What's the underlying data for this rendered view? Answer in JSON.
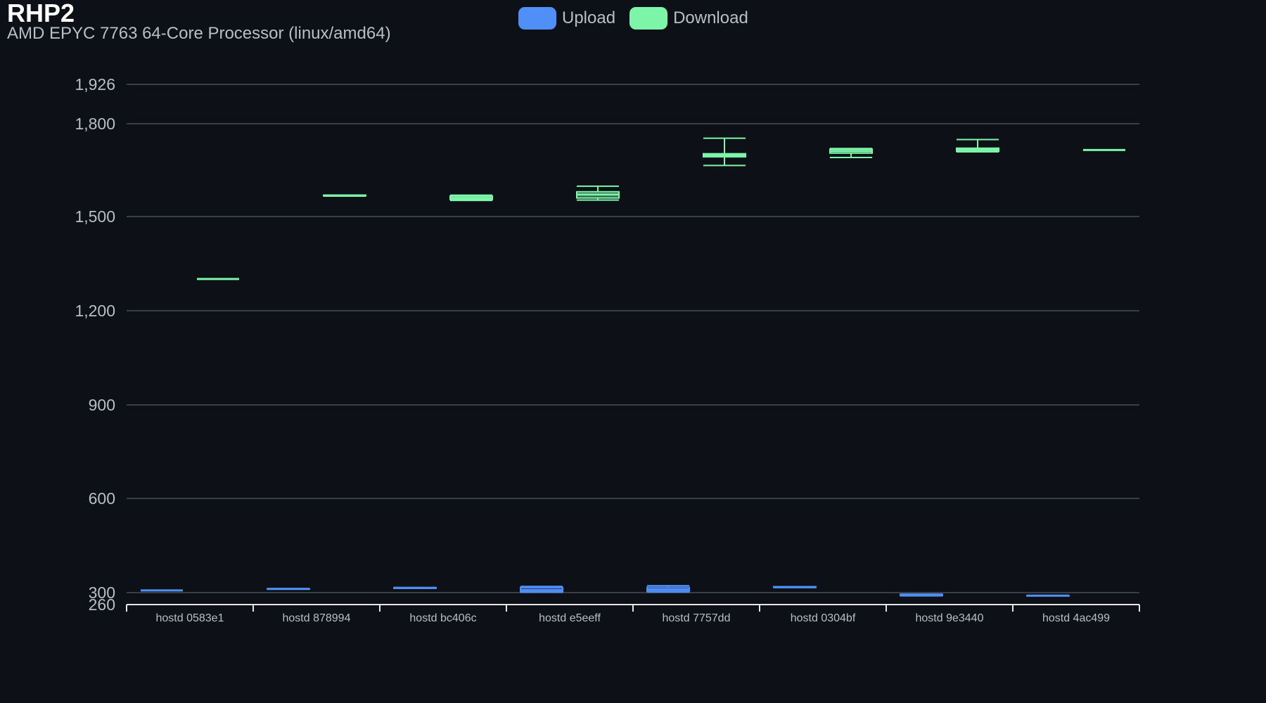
{
  "header": {
    "title": "RHP2",
    "subtitle": "AMD EPYC 7763 64-Core Processor (linux/amd64)"
  },
  "chart_data": {
    "type": "boxplot",
    "title": "RHP2",
    "subtitle": "AMD EPYC 7763 64-Core Processor (linux/amd64)",
    "xlabel": "",
    "ylabel": "",
    "ylim": [
      260,
      1926
    ],
    "yticks": [
      1926,
      1800,
      1500,
      1200,
      900,
      600,
      300,
      260
    ],
    "ytick_labels": [
      "1,926",
      "1,800",
      "1,500",
      "1,200",
      "900",
      "600",
      "300",
      "260"
    ],
    "grid": true,
    "legend_position": "top-center",
    "categories": [
      "hostd 0583e1",
      "hostd 878994",
      "hostd bc406c",
      "hostd e5eeff",
      "hostd 7757dd",
      "hostd 0304bf",
      "hostd 9e3440",
      "hostd 4ac499"
    ],
    "series": [
      {
        "name": "Upload",
        "color": "#4f8ff7",
        "boxes": [
          {
            "min": 307,
            "q1": 307,
            "median": 307,
            "q3": 307,
            "max": 307
          },
          {
            "min": 311,
            "q1": 311,
            "median": 312,
            "q3": 312,
            "max": 312
          },
          {
            "min": 314,
            "q1": 314,
            "median": 315,
            "q3": 316,
            "max": 316
          },
          {
            "min": 301,
            "q1": 303,
            "median": 308,
            "q3": 316,
            "max": 320
          },
          {
            "min": 302,
            "q1": 304,
            "median": 310,
            "q3": 317,
            "max": 322
          },
          {
            "min": 316,
            "q1": 317,
            "median": 318,
            "q3": 319,
            "max": 319
          },
          {
            "min": 289,
            "q1": 290,
            "median": 292,
            "q3": 294,
            "max": 295
          },
          {
            "min": 289,
            "q1": 289,
            "median": 290,
            "q3": 290,
            "max": 290
          }
        ]
      },
      {
        "name": "Download",
        "color": "#7cf5a8",
        "boxes": [
          {
            "min": 1301,
            "q1": 1301,
            "median": 1301,
            "q3": 1301,
            "max": 1301
          },
          {
            "min": 1566,
            "q1": 1567,
            "median": 1568,
            "q3": 1569,
            "max": 1569
          },
          {
            "min": 1552,
            "q1": 1555,
            "median": 1560,
            "q3": 1566,
            "max": 1569
          },
          {
            "min": 1553,
            "q1": 1560,
            "median": 1571,
            "q3": 1580,
            "max": 1598
          },
          {
            "min": 1665,
            "q1": 1693,
            "median": 1698,
            "q3": 1703,
            "max": 1753
          },
          {
            "min": 1691,
            "q1": 1705,
            "median": 1712,
            "q3": 1718,
            "max": 1720
          },
          {
            "min": 1709,
            "q1": 1711,
            "median": 1716,
            "q3": 1721,
            "max": 1749
          },
          {
            "min": 1715,
            "q1": 1715,
            "median": 1715,
            "q3": 1715,
            "max": 1715
          }
        ]
      }
    ]
  }
}
